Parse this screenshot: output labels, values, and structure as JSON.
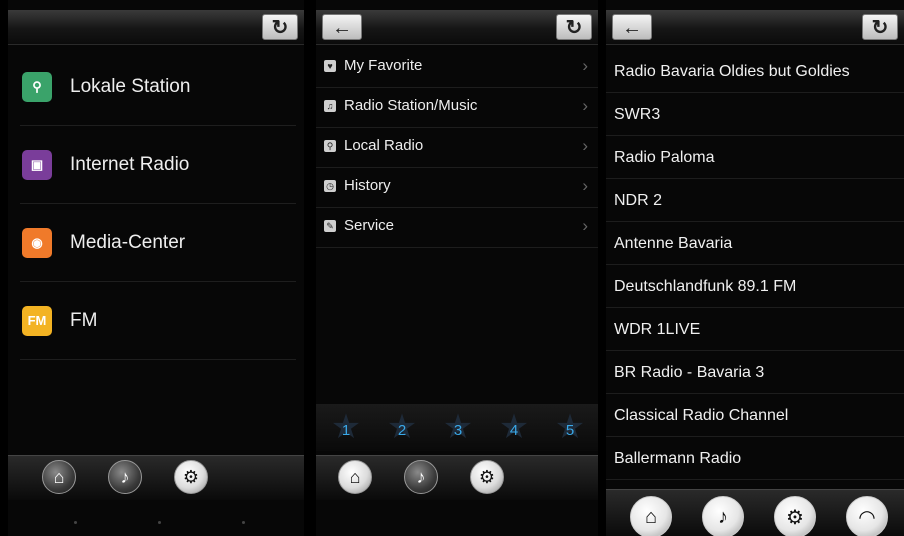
{
  "panel1": {
    "items": [
      {
        "label": "Lokale Station",
        "icon": "location-pin-icon",
        "color": "#3aa36a"
      },
      {
        "label": "Internet Radio",
        "icon": "radio-icon",
        "color": "#7a3d9a"
      },
      {
        "label": "Media-Center",
        "icon": "disc-icon",
        "color": "#f07a2a"
      },
      {
        "label": "FM",
        "icon": "fm-icon",
        "color": "#f3b323"
      }
    ],
    "icon_glyphs": {
      "pin": "⚲",
      "radio": "▣",
      "disc": "◉",
      "fm": "FM"
    },
    "nav": {
      "home": "⌂",
      "music": "♪",
      "settings": "⚙"
    }
  },
  "panel2": {
    "items": [
      {
        "label": "My Favorite",
        "icon": "heart-icon"
      },
      {
        "label": "Radio Station/Music",
        "icon": "music-note-icon"
      },
      {
        "label": "Local Radio",
        "icon": "location-icon"
      },
      {
        "label": "History",
        "icon": "clock-icon"
      },
      {
        "label": "Service",
        "icon": "service-icon"
      }
    ],
    "chevron": "›",
    "presets": [
      "1",
      "2",
      "3",
      "4",
      "5"
    ],
    "star": "★",
    "nav": {
      "home": "⌂",
      "music": "♪",
      "settings": "⚙"
    }
  },
  "panel3": {
    "stations": [
      "Radio Bavaria Oldies but Goldies",
      "SWR3",
      "Radio Paloma",
      "NDR 2",
      "Antenne Bavaria",
      "Deutschlandfunk 89.1 FM",
      "WDR 1LIVE",
      "BR Radio - Bavaria 3",
      "Classical Radio Channel",
      "Ballermann Radio"
    ],
    "nav": {
      "home": "⌂",
      "music": "♪",
      "settings": "⚙",
      "wifi": "◠"
    }
  },
  "topbar": {
    "refresh": "↻",
    "back": "←"
  },
  "colors": {
    "preset_number": "#3aa8e8",
    "background": "#070707"
  }
}
